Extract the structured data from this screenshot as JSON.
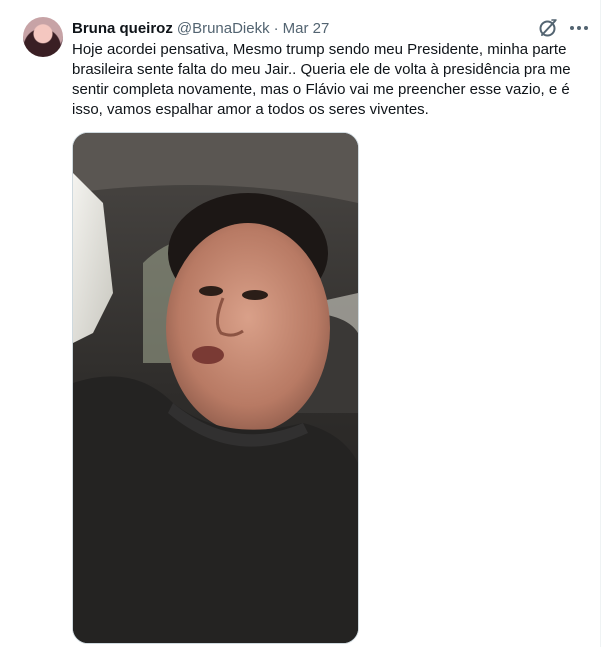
{
  "tweet": {
    "display_name": "Bruna queiroz",
    "handle": "@BrunaDiekk",
    "separator": "·",
    "date": "Mar 27",
    "text": "Hoje acordei pensativa, Mesmo trump sendo meu Presidente, minha parte\nbrasileira sente falta do meu Jair.. Queria ele de volta à presidência pra me\nsentir completa novamente, mas o Flávio vai me preencher esse vazio, e é\nisso, vamos espalhar amor a todos os seres viventes."
  },
  "icons": {
    "grok": "grok-icon",
    "more": "more-icon"
  },
  "colors": {
    "text_primary": "#0f1419",
    "text_secondary": "#536471",
    "border": "#cfd9de"
  }
}
